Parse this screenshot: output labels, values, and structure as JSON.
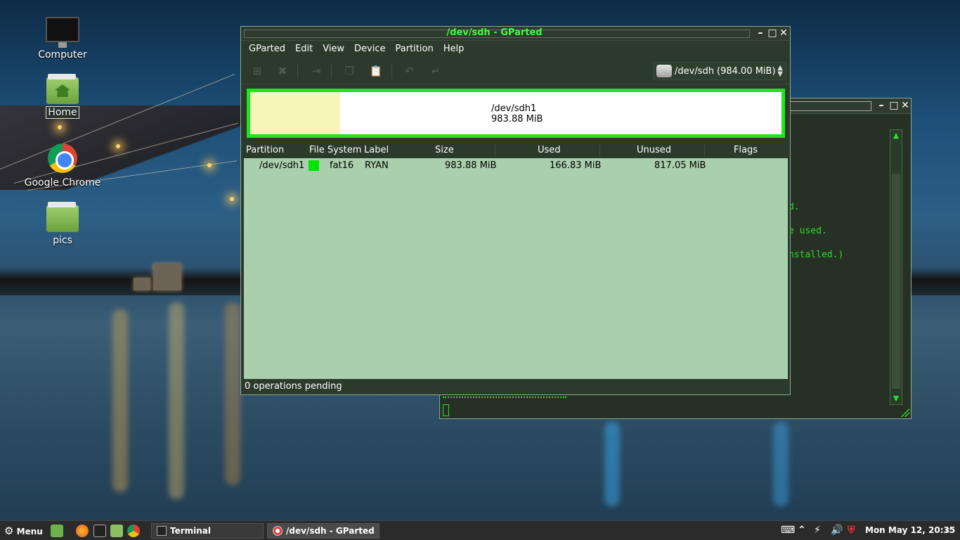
{
  "desktop": {
    "icons": [
      {
        "label": "Computer"
      },
      {
        "label": "Home"
      },
      {
        "label": "Google Chrome"
      },
      {
        "label": "pics"
      }
    ]
  },
  "terminal": {
    "lines": [
      "d.",
      "e used.",
      "nstalled.)"
    ]
  },
  "gparted": {
    "title": "/dev/sdh - GParted",
    "menu": [
      "GParted",
      "Edit",
      "View",
      "Device",
      "Partition",
      "Help"
    ],
    "device_selector": {
      "name": "/dev/sdh",
      "size": "(984.00 MiB)"
    },
    "diskmap": {
      "partition": "/dev/sdh1",
      "size": "983.88 MiB"
    },
    "table": {
      "headers": [
        "Partition",
        "File System",
        "Label",
        "Size",
        "Used",
        "Unused",
        "Flags"
      ],
      "rows": [
        {
          "partition": "/dev/sdh1",
          "filesystem": "fat16",
          "label": "RYAN",
          "size": "983.88 MiB",
          "used": "166.83 MiB",
          "unused": "817.05 MiB",
          "flags": ""
        }
      ]
    },
    "status": "0 operations pending",
    "colors": {
      "title": "#3dff3d",
      "fat16": "#00e400",
      "map_border": "#18e818",
      "table_bg": "#aacfac"
    }
  },
  "taskbar": {
    "menu_label": "Menu",
    "tasks": [
      {
        "label": "Terminal"
      },
      {
        "label": "/dev/sdh - GParted"
      }
    ],
    "clock": "Mon May 12, 20:35"
  }
}
